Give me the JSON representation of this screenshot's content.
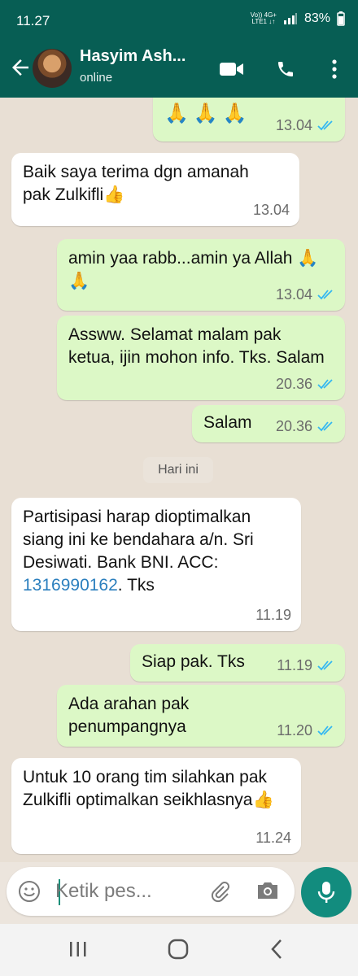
{
  "status_bar": {
    "time": "11.27",
    "network_top": "Vo)) 4G+",
    "network_bottom": "LTE1 ↓↑",
    "battery": "83%"
  },
  "header": {
    "contact_name": "Hasyim Ash...",
    "status": "online"
  },
  "messages": [
    {
      "direction": "out",
      "text": "🙏🙏🙏",
      "time": "13.04",
      "read": true
    },
    {
      "direction": "in",
      "text": "Baik saya terima dgn amanah pak Zulkifli👍",
      "time": "13.04"
    },
    {
      "direction": "out",
      "text": "amin yaa rabb...amin ya Allah 🙏🙏",
      "time": "13.04",
      "read": true
    },
    {
      "direction": "out",
      "text": "Assww. Selamat malam pak ketua, ijin mohon info.  Tks. Salam",
      "time": "20.36",
      "read": true
    },
    {
      "direction": "out",
      "text": "Salam",
      "time": "20.36",
      "read": true
    },
    {
      "direction": "in",
      "text_before": "Partisipasi harap dioptimalkan siang ini ke bendahara a/n. Sri Desiwati. Bank BNI. ACC: ",
      "link": "1316990162",
      "text_after": ". Tks",
      "time": "11.19"
    },
    {
      "direction": "out",
      "text": "Siap pak. Tks",
      "time": "11.19",
      "read": true
    },
    {
      "direction": "out",
      "text": "Ada arahan pak penumpangnya",
      "time": "11.20",
      "read": true
    },
    {
      "direction": "in",
      "text": "Untuk 10 orang tim silahkan pak Zulkifli optimalkan seikhlasnya👍",
      "time": "11.24"
    }
  ],
  "day_divider": "Hari ini",
  "composer": {
    "placeholder": "Ketik pes..."
  },
  "colors": {
    "header": "#075e54",
    "outgoing_bubble": "#dcf8c6",
    "incoming_bubble": "#ffffff",
    "read_ticks": "#34b7f1",
    "mic_button": "#128c7e"
  }
}
